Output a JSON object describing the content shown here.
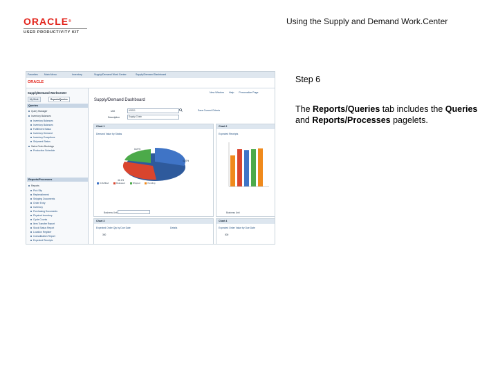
{
  "header": {
    "logo_brand": "ORACLE",
    "logo_sub": "USER PRODUCTIVITY KIT",
    "title": "Using the Supply and Demand Work.Center"
  },
  "step": {
    "title": "Step 6",
    "desc_1": "The ",
    "desc_2": "Reports/Queries",
    "desc_3": " tab includes the ",
    "desc_4": "Queries",
    "desc_5": " and ",
    "desc_6": "Reports/Processes",
    "desc_7": " pagelets."
  },
  "colors": {
    "accent_red": "#e2231a",
    "pie_blue": "#3f74c6",
    "pie_green": "#4caa4a",
    "pie_red": "#d9452e",
    "bar_orange": "#f08a1c",
    "bar_blue": "#3f74c6",
    "bar_green": "#4caa4a",
    "bar_red": "#d9452e"
  },
  "screenshot": {
    "nav": [
      "Favorites",
      "Main Menu",
      "Inventory",
      "Supply/Demand Work Center",
      "Supply/Demand Dashboard"
    ],
    "oracle_logo": "ORACLE",
    "top_links": [
      "New Window",
      "Help",
      "Personalize Page"
    ],
    "work_center": {
      "title": "Supply/Demand WorkCenter",
      "tabs": [
        "My Work",
        "Reports/Queries"
      ],
      "queries_header": "Queries",
      "queries_items": [
        "Query Manager",
        "Inventory Balances",
        "Inventory Balances",
        "Inventory Balances",
        "Fulfillment Status",
        "Inventory Demand",
        "Inventory Exceptions",
        "Shipment Status",
        "Sales Order Bookings",
        "Production Schedule"
      ],
      "reports_header": "Reports/Processes",
      "reports_items": [
        "Reports",
        "Pick Slip",
        "Replenishment",
        "Shipping Documents",
        "Order Entry",
        "Inventory",
        "Purchasing Documents",
        "Physical Inventory",
        "Cycle Counts",
        "Item Transfer Report",
        "Stock Status Report",
        "Location Register",
        "Consolidation Report",
        "Expected Receipts"
      ]
    },
    "dashboard": {
      "title": "Supply/Demand Dashboard",
      "unit_label": "Unit",
      "unit_value": "US001",
      "desc_label": "Description",
      "desc_value": "Supply Chain",
      "criteria_button": "Save Current Criteria",
      "chart1_header": "Chart 1",
      "chart1_title": "Demand Value by Status",
      "chart1_pct": [
        "41.1%",
        "42.0%",
        "16.9%"
      ],
      "chart1_legend": [
        "Unfulfilled",
        "Released",
        "Shipped",
        "Pending"
      ],
      "chart1_foot": "Business Unit",
      "chart2_header": "Chart 2",
      "chart2_title": "Expected Receipts",
      "chart2_bars": [
        0.75,
        0.9,
        0.88,
        0.9,
        0.92
      ],
      "chart2_foot": "Business Unit",
      "chart3_header": "Chart 3",
      "chart3_title": "Expected Order Qty by Due Date",
      "chart3_link": "Details",
      "chart3_axis": "300",
      "chart4_header": "Chart 4",
      "chart4_title": "Expected Order Value by Due Date",
      "chart4_axis": "500"
    }
  }
}
